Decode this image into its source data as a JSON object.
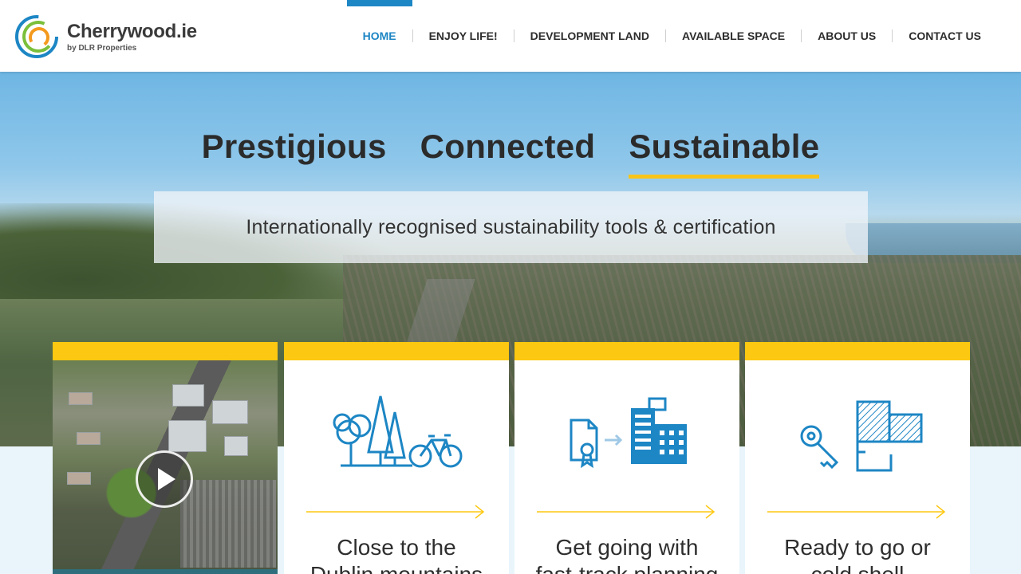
{
  "brand": {
    "name": "Cherrywood.ie",
    "byline": "by DLR Properties",
    "colors": {
      "accent": "#1d86c4",
      "highlight": "#fdc811",
      "text": "#2d2d2d"
    }
  },
  "nav": {
    "items": [
      {
        "label": "HOME",
        "active": true
      },
      {
        "label": "ENJOY LIFE!",
        "active": false
      },
      {
        "label": "DEVELOPMENT LAND",
        "active": false
      },
      {
        "label": "AVAILABLE SPACE",
        "active": false
      },
      {
        "label": "ABOUT US",
        "active": false
      },
      {
        "label": "CONTACT US",
        "active": false
      }
    ]
  },
  "hero": {
    "taglines": [
      {
        "label": "Prestigious",
        "active": false
      },
      {
        "label": "Connected",
        "active": false
      },
      {
        "label": "Sustainable",
        "active": true
      }
    ],
    "subtitle": "Internationally recognised sustainability tools & certification"
  },
  "cards": [
    {
      "type": "video",
      "icon": "play-icon"
    },
    {
      "type": "feature",
      "icon": "trees-bicycle-icon",
      "title_line1": "Close to the",
      "title_line2": "Dublin mountains"
    },
    {
      "type": "feature",
      "icon": "certificate-building-icon",
      "title_line1": "Get going with",
      "title_line2": "fast-track planning"
    },
    {
      "type": "feature",
      "icon": "key-floorplan-icon",
      "title_line1": "Ready to go or",
      "title_line2": "cold shell"
    }
  ]
}
